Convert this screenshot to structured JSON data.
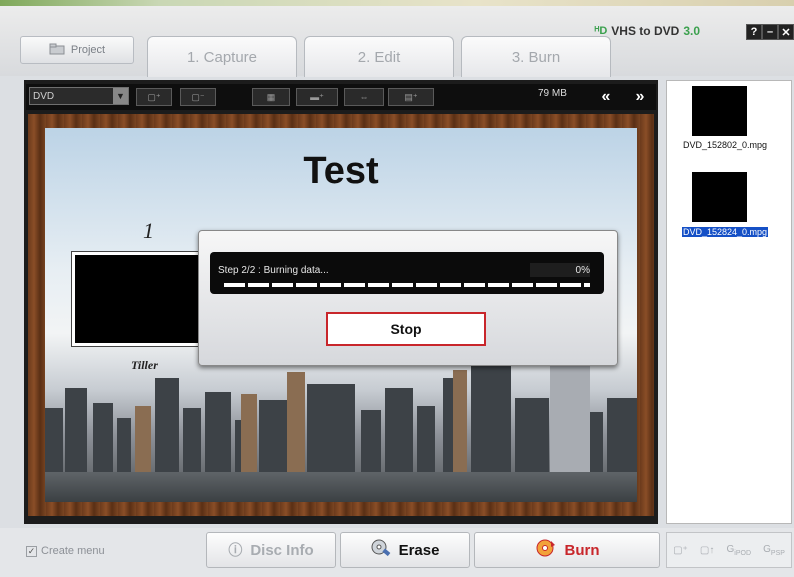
{
  "header": {
    "project_label": "Project",
    "tabs": [
      "1. Capture",
      "2. Edit",
      "3. Burn"
    ],
    "app_name": "VHS to DVD",
    "app_version": "3.0",
    "window_buttons": [
      "?",
      "–",
      "✕"
    ]
  },
  "toolbar": {
    "format_value": "DVD",
    "size_label": "79 MB",
    "prev_symbol": "«",
    "next_symbol": "»"
  },
  "menu_preview": {
    "title": "Test",
    "thumb_number": "1",
    "thumb_label": "Tiller"
  },
  "burn_dialog": {
    "status_text": "Step 2/2 : Burning data...",
    "percent_text": "0%",
    "progress": 0,
    "stop_label": "Stop"
  },
  "files": [
    {
      "name": "DVD_152802_0.mpg",
      "selected": false
    },
    {
      "name": "DVD_152824_0.mpg",
      "selected": true
    }
  ],
  "footer": {
    "create_menu_label": "Create menu",
    "create_menu_checked": true,
    "disc_info_label": "Disc Info",
    "erase_label": "Erase",
    "burn_label": "Burn",
    "ipod_label": "iPOD",
    "psp_label": "PSP"
  },
  "colors": {
    "accent_red": "#c8262b",
    "brand_green": "#3aa04d",
    "selection_blue": "#1550c6"
  }
}
